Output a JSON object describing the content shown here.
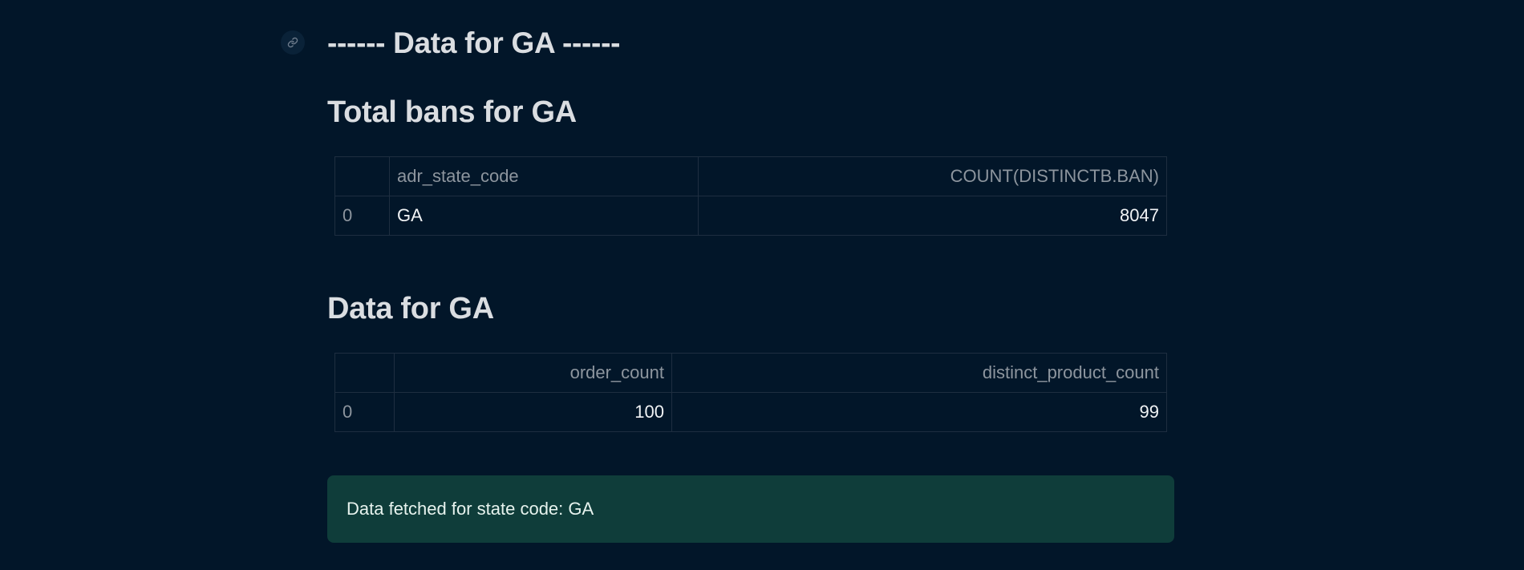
{
  "header": {
    "title": "------ Data for GA ------",
    "anchor_icon": "link-icon"
  },
  "sections": [
    {
      "title": "Total bans for GA",
      "table": {
        "columns": [
          "",
          "adr_state_code",
          "COUNT(DISTINCTB.BAN)"
        ],
        "rows": [
          [
            "0",
            "GA",
            "8047"
          ]
        ]
      }
    },
    {
      "title": "Data for GA",
      "table": {
        "columns": [
          "",
          "order_count",
          "distinct_product_count"
        ],
        "rows": [
          [
            "0",
            "100",
            "99"
          ]
        ]
      }
    }
  ],
  "alert": {
    "type": "success",
    "message": "Data fetched for state code: GA"
  },
  "colors": {
    "background": "#021629",
    "success_background": "#0f3d3a",
    "table_border": "#1e2e40",
    "header_text": "#8d959e"
  }
}
